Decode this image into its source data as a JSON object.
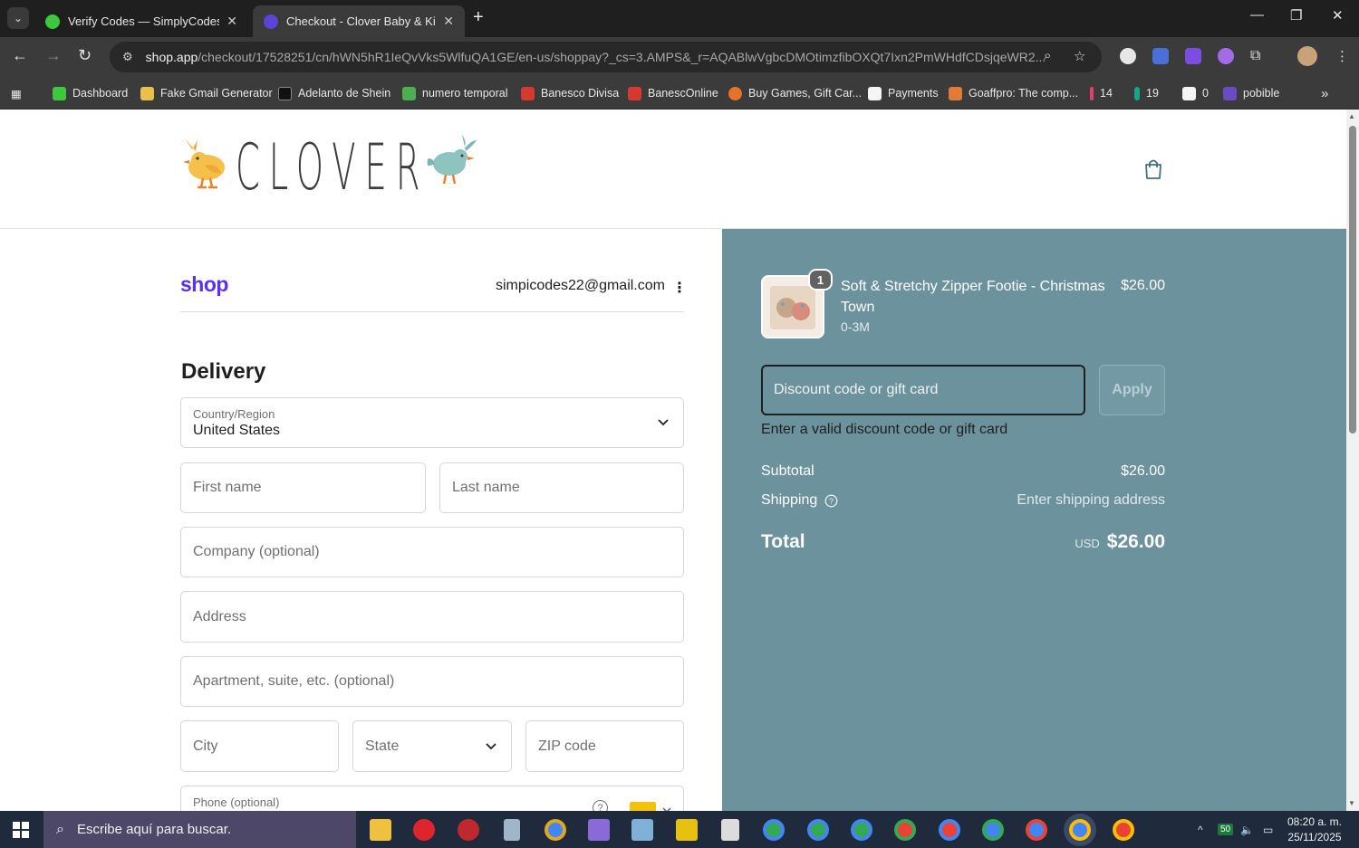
{
  "browser": {
    "tabs": [
      {
        "title": "Verify Codes — SimplyCodes",
        "close": "✕"
      },
      {
        "title": "Checkout - Clover Baby & Kids",
        "close": "✕"
      }
    ],
    "new_tab": "+",
    "window_controls": {
      "minimize": "—",
      "maximize": "❐",
      "close": "✕"
    },
    "url": {
      "host": "shop.app",
      "path": "/checkout/17528251/cn/hWN5hR1IeQvVks5WlfuQA1GE/en-us/shoppay?_cs=3.AMPS&_r=AQABlwVgbcDMOtimzfibOXQt7Ixn2PmWHdfCDsjqeWR2..."
    },
    "bookmarks": [
      {
        "label": "Dashboard",
        "color": "#3ec83e"
      },
      {
        "label": "Fake Gmail Generator",
        "color": "#e8c04a"
      },
      {
        "label": "Adelanto de Shein",
        "color": "#111111"
      },
      {
        "label": "numero temporal",
        "color": "#4caf50"
      },
      {
        "label": "Banesco Divisa",
        "color": "#d63a2f"
      },
      {
        "label": "BanescOnline",
        "color": "#d63a2f"
      },
      {
        "label": "Buy Games, Gift Car...",
        "color": "#e8722a"
      },
      {
        "label": "Payments",
        "color": "#f5f5f5"
      },
      {
        "label": "Goaffpro: The comp...",
        "color": "#e07b39"
      },
      {
        "label": "14",
        "color": "#e83e6c"
      },
      {
        "label": "19",
        "color": "#17a589"
      },
      {
        "label": "0",
        "color": "#f5f5f5"
      },
      {
        "label": "pobible",
        "color": "#6a4bc4"
      }
    ],
    "bookmarks_more": "»"
  },
  "store": {
    "logo_text": "CLOVER"
  },
  "checkout": {
    "shop_brand": "shop",
    "email": "simpicodes22@gmail.com",
    "delivery_heading": "Delivery",
    "country": {
      "label": "Country/Region",
      "value": "United States"
    },
    "fields": {
      "first_name": "First name",
      "last_name": "Last name",
      "company": "Company (optional)",
      "address": "Address",
      "apartment": "Apartment, suite, etc. (optional)",
      "city": "City",
      "state": "State",
      "zip": "ZIP code",
      "phone": "Phone (optional)"
    }
  },
  "summary": {
    "item": {
      "quantity": "1",
      "title": "Soft & Stretchy Zipper Footie - Christmas Town",
      "variant": "0-3M",
      "price": "$26.00"
    },
    "discount_placeholder": "Discount code or gift card",
    "apply_label": "Apply",
    "discount_error": "Enter a valid discount code or gift card",
    "subtotal_label": "Subtotal",
    "subtotal_value": "$26.00",
    "shipping_label": "Shipping",
    "shipping_value": "Enter shipping address",
    "total_label": "Total",
    "currency": "USD",
    "total_value": "$26.00"
  },
  "taskbar": {
    "search_placeholder": "Escribe aquí para buscar.",
    "tray_badge": "50",
    "time": "08:20 a. m.",
    "date": "25/11/2025"
  }
}
